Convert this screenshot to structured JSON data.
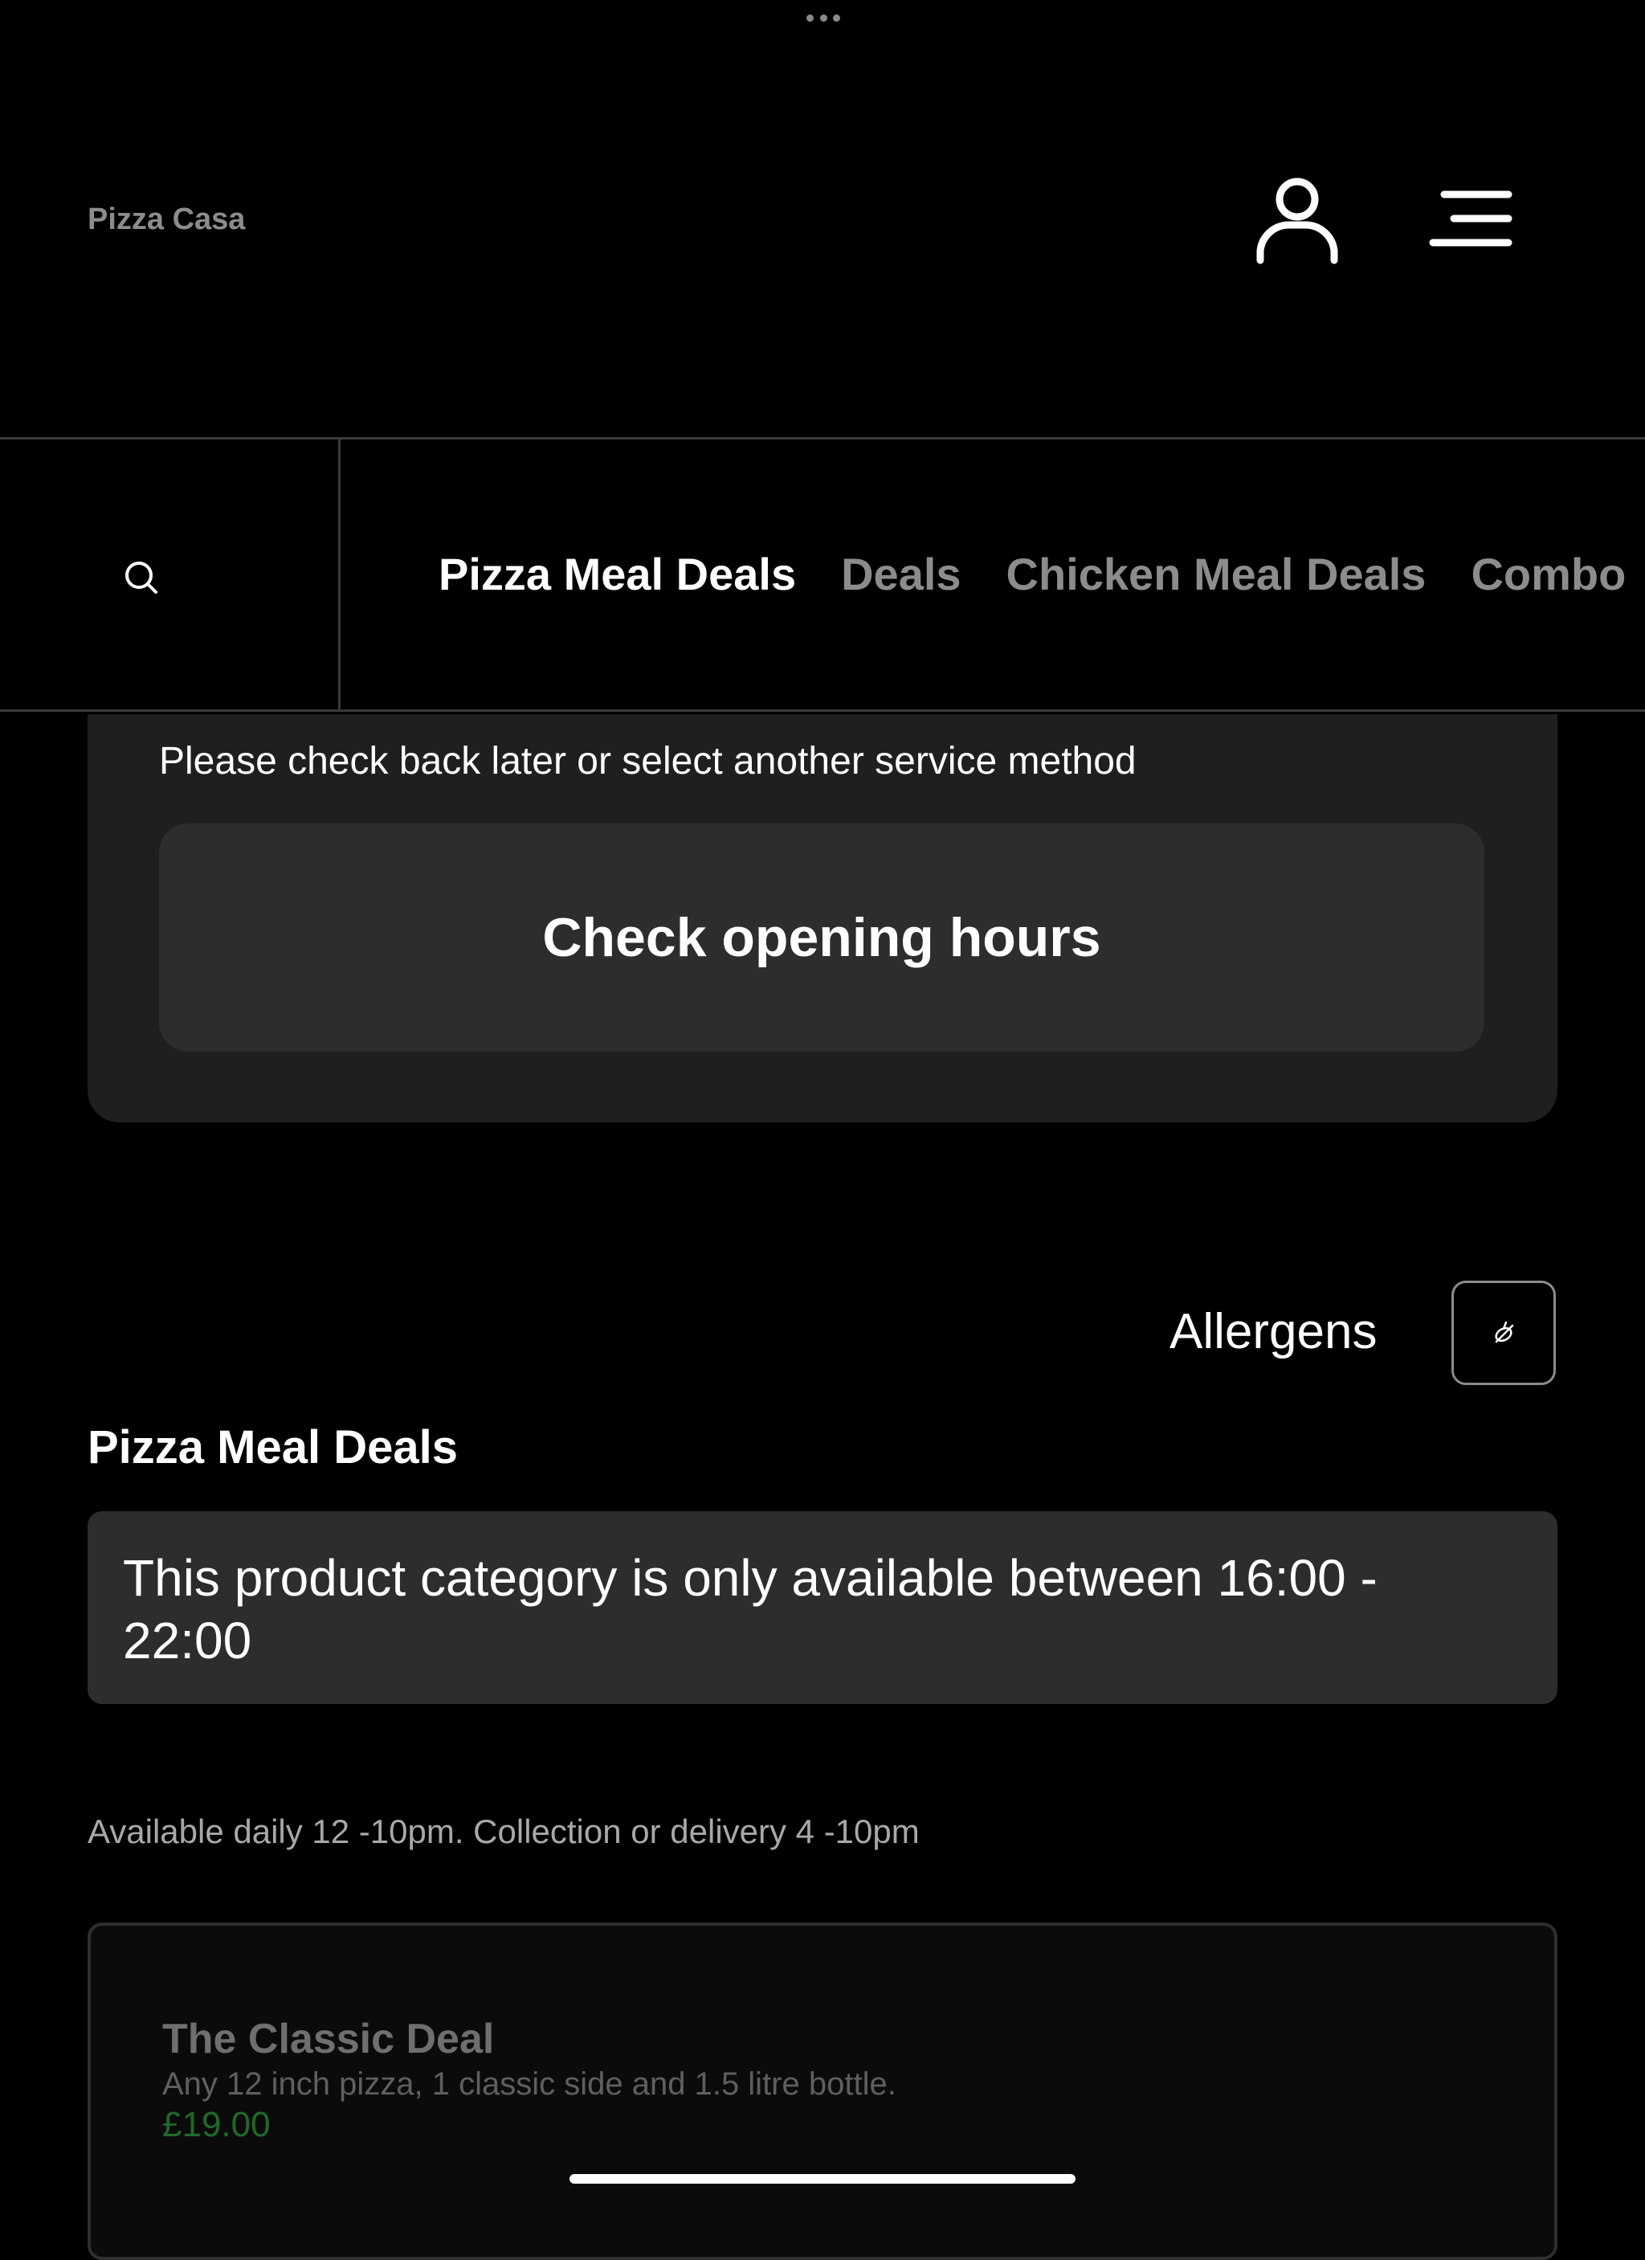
{
  "header": {
    "brand": "Pizza Casa",
    "account_icon": "user-icon",
    "menu_icon": "hamburger-menu-icon"
  },
  "nav": {
    "search_icon": "search-icon",
    "tabs": [
      {
        "label": "Pizza Meal Deals",
        "active": true
      },
      {
        "label": "Deals",
        "active": false
      },
      {
        "label": "Chicken Meal Deals",
        "active": false
      },
      {
        "label": "Combo",
        "active": false
      }
    ]
  },
  "notice": {
    "message": "Please check back later or select another service method",
    "button_label": "Check opening hours"
  },
  "allergens": {
    "label": "Allergens",
    "icon": "allergen-filter-icon"
  },
  "section": {
    "title": "Pizza Meal Deals",
    "availability": "This product category is only available  between 16:00 - 22:00",
    "info": "Available daily 12 -10pm. Collection or delivery 4 -10pm"
  },
  "products": [
    {
      "name": "The Classic Deal",
      "description": "Any 12 inch pizza, 1 classic side and 1.5 litre bottle.",
      "price": "£19.00"
    }
  ],
  "colors": {
    "background": "#000000",
    "card": "#1f1f1f",
    "button": "#2d2d2d",
    "muted_text": "#8c8c8c",
    "price": "#1f6a2a"
  }
}
